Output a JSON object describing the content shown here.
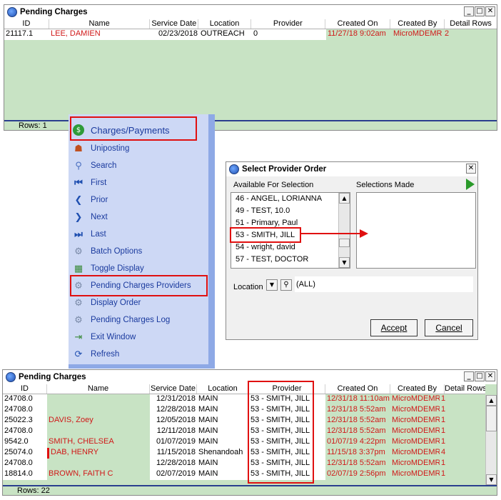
{
  "top_window": {
    "title": "Pending Charges",
    "columns": [
      "ID",
      "Name",
      "Service Date",
      "Location",
      "Provider",
      "Created On",
      "Created By",
      "Detail Rows"
    ],
    "rows": [
      {
        "id": "21117.1",
        "name": "LEE, DAMIEN",
        "service_date": "02/23/2018",
        "location": "OUTREACH",
        "provider": "0",
        "created_on": "11/27/18 9:02am",
        "created_by": "MicroMDEMR",
        "detail_rows": "2"
      }
    ],
    "rows_count": "Rows: 1"
  },
  "menu": {
    "items": [
      {
        "label": "Charges/Payments",
        "icon": "dollar-icon"
      },
      {
        "label": "Uniposting",
        "icon": "people-icon"
      },
      {
        "label": "Search",
        "icon": "magnifier-icon"
      },
      {
        "label": "First",
        "icon": "first-icon"
      },
      {
        "label": "Prior",
        "icon": "prior-icon"
      },
      {
        "label": "Next",
        "icon": "next-icon"
      },
      {
        "label": "Last",
        "icon": "last-icon"
      },
      {
        "label": "Batch Options",
        "icon": "gear-icon"
      },
      {
        "label": "Toggle Display",
        "icon": "toggle-icon"
      },
      {
        "label": "Pending Charges Providers",
        "icon": "gear-icon"
      },
      {
        "label": "Display Order",
        "icon": "gear-icon"
      },
      {
        "label": "Pending Charges Log",
        "icon": "gear-icon"
      },
      {
        "label": "Exit Window",
        "icon": "exit-icon"
      },
      {
        "label": "Refresh",
        "icon": "refresh-icon"
      }
    ]
  },
  "dialog": {
    "title": "Select Provider Order",
    "available_label": "Available For Selection",
    "selections_label": "Selections Made",
    "available_items": [
      "46 - ANGEL, LORIANNA",
      "49 - TEST, 10.0",
      "51 - Primary, Paul",
      "53 - SMITH, JILL",
      "54 - wright, david",
      "57 - TEST, DOCTOR"
    ],
    "location_label": "Location",
    "location_value": "(ALL)",
    "accept_label": "Accept",
    "cancel_label": "Cancel"
  },
  "bottom_window": {
    "title": "Pending Charges",
    "columns": [
      "ID",
      "Name",
      "Service Date",
      "Location",
      "Provider",
      "Created On",
      "Created By",
      "Detail Rows"
    ],
    "rows": [
      {
        "id": "24708.0",
        "name": "",
        "service_date": "12/31/2018",
        "location": "MAIN",
        "provider": "53 - SMITH, JILL",
        "created_on": "12/31/18 11:10am",
        "created_by": "MicroMDEMR",
        "detail_rows": "1"
      },
      {
        "id": "24708.0",
        "name": "",
        "service_date": "12/28/2018",
        "location": "MAIN",
        "provider": "53 - SMITH, JILL",
        "created_on": "12/31/18 5:52am",
        "created_by": "MicroMDEMR",
        "detail_rows": "1"
      },
      {
        "id": "25022.3",
        "name": "DAVIS, Zoey",
        "service_date": "12/05/2018",
        "location": "MAIN",
        "provider": "53 - SMITH, JILL",
        "created_on": "12/31/18 5:52am",
        "created_by": "MicroMDEMR",
        "detail_rows": "1"
      },
      {
        "id": "24708.0",
        "name": "",
        "service_date": "12/11/2018",
        "location": "MAIN",
        "provider": "53 - SMITH, JILL",
        "created_on": "12/31/18 5:52am",
        "created_by": "MicroMDEMR",
        "detail_rows": "1"
      },
      {
        "id": "9542.0",
        "name": "SMITH, CHELSEA",
        "service_date": "01/07/2019",
        "location": "MAIN",
        "provider": "53 - SMITH, JILL",
        "created_on": "01/07/19 4:22pm",
        "created_by": "MicroMDEMR",
        "detail_rows": "1"
      },
      {
        "id": "25074.0",
        "name": "DAB, HENRY",
        "service_date": "11/15/2018",
        "location": "Shenandoah",
        "provider": "53 - SMITH, JILL",
        "created_on": "11/15/18 3:37pm",
        "created_by": "MicroMDEMR",
        "detail_rows": "4"
      },
      {
        "id": "24708.0",
        "name": "",
        "service_date": "12/28/2018",
        "location": "MAIN",
        "provider": "53 - SMITH, JILL",
        "created_on": "12/31/18 5:52am",
        "created_by": "MicroMDEMR",
        "detail_rows": "1"
      },
      {
        "id": "18814.0",
        "name": "BROWN, FAITH C",
        "service_date": "02/07/2019",
        "location": "MAIN",
        "provider": "53 - SMITH, JILL",
        "created_on": "02/07/19 2:56pm",
        "created_by": "MicroMDEMR",
        "detail_rows": "1"
      }
    ],
    "rows_count": "Rows: 22"
  }
}
